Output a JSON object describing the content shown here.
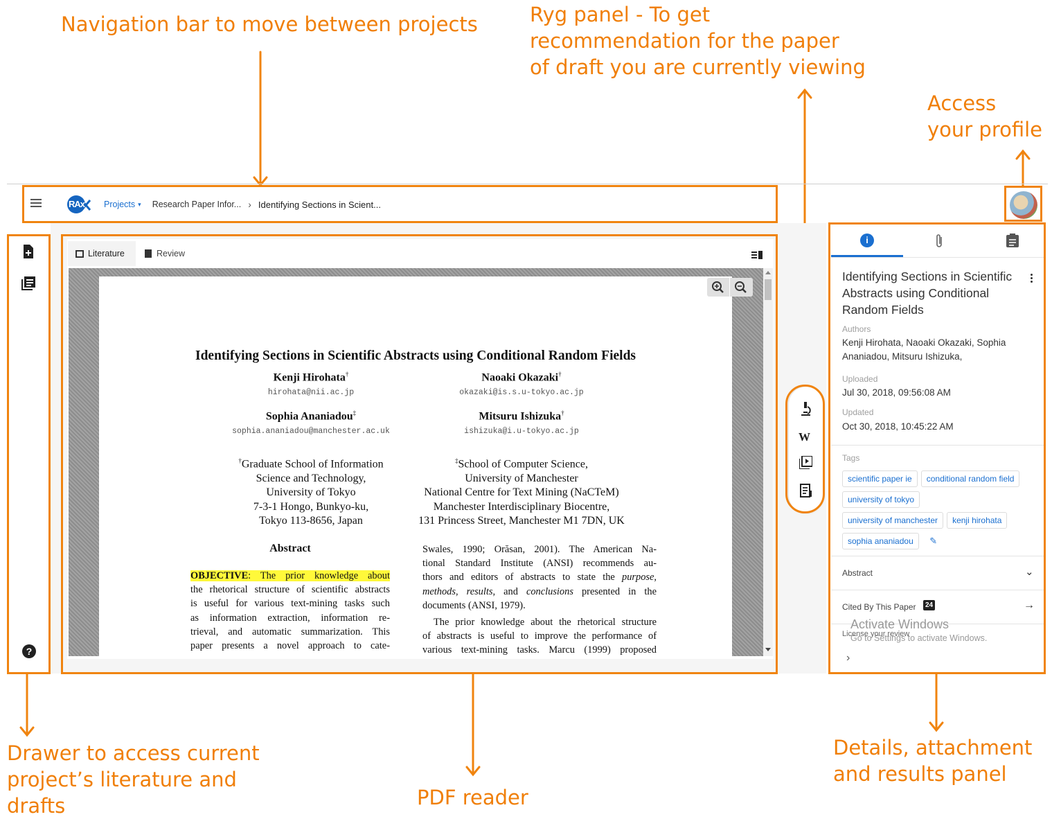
{
  "annotations": {
    "nav": "Navigation bar to move between projects",
    "ryg": [
      "Ryg panel - To get",
      "recommendation for the paper",
      "of draft you are currently viewing"
    ],
    "profile": [
      "Access",
      "your profile"
    ],
    "drawer": [
      "Drawer to access current",
      "project’s literature and",
      "drafts"
    ],
    "pdf": "PDF reader",
    "details": [
      "Details, attachment",
      "and results panel"
    ]
  },
  "appbar": {
    "logo": "RAx",
    "projects": "Projects",
    "crumb_project": "Research Paper Infor...",
    "crumb_separator": "›",
    "crumb_current": "Identifying Sections in Scient..."
  },
  "reader": {
    "tabs": [
      {
        "label": "Literature"
      },
      {
        "label": "Review"
      }
    ]
  },
  "paper": {
    "title": "Identifying Sections in Scientific Abstracts using Conditional Random Fields",
    "authors": [
      {
        "name": "Kenji Hirohata",
        "mark": "†",
        "email": "hirohata@nii.ac.jp"
      },
      {
        "name": "Naoaki Okazaki",
        "mark": "†",
        "email": "okazaki@is.s.u-tokyo.ac.jp"
      },
      {
        "name": "Sophia Ananiadou",
        "mark": "‡",
        "email": "sophia.ananiadou@manchester.ac.uk"
      },
      {
        "name": "Mitsuru Ishizuka",
        "mark": "†",
        "email": "ishizuka@i.u-tokyo.ac.jp"
      }
    ],
    "aff1": [
      "Graduate School of Information",
      "Science and Technology,",
      "University of Tokyo",
      "7-3-1 Hongo, Bunkyo-ku,",
      "Tokyo 113-8656, Japan"
    ],
    "aff1_mark": "†",
    "aff2": [
      "School of Computer Science,",
      "University of Manchester",
      "National Centre for Text Mining (NaCTeM)",
      "Manchester Interdisciplinary Biocentre,",
      "131 Princess Street, Manchester M1 7DN, UK"
    ],
    "aff2_mark": "‡",
    "abstract_heading": "Abstract",
    "obj_label": "OBJECTIVE",
    "obj_text": ": The prior knowledge about",
    "left_col": [
      "the rhetorical structure of scientific abstracts",
      "is useful for various text-mining tasks such",
      "as information extraction, information re-",
      "trieval, and automatic summarization. This",
      "paper presents a novel approach to cate-"
    ],
    "right_col_1": [
      "Swales, 1990; Orăsan, 2001). The American Na-",
      "tional Standard Institute (ANSI) recommends au-"
    ],
    "right_col_2a": "thors and editors of abstracts to state the ",
    "right_col_2b": "purpose",
    "right_col_3a": "methods",
    "right_col_3b": ", ",
    "right_col_3c": "results",
    "right_col_3d": ", and ",
    "right_col_3e": "conclusions",
    "right_col_3f": " presented in the",
    "right_col_4": "documents (ANSI, 1979).",
    "right_col_5": [
      "The prior knowledge about the rhetorical structure",
      "of abstracts is useful to improve the performance of",
      "various text-mining tasks. Marcu (1999) proposed"
    ]
  },
  "ryg_icons": [
    "microscope-icon",
    "wikipedia-icon",
    "video-icon",
    "article-icon"
  ],
  "ryg_wiki_letter": "W",
  "details": {
    "title": "Identifying Sections in Scientific Abstracts using Conditional Random Fields",
    "authors_label": "Authors",
    "authors": "Kenji Hirohata, Naoaki Okazaki, Sophia Ananiadou, Mitsuru Ishizuka,",
    "uploaded_label": "Uploaded",
    "uploaded": "Jul 30, 2018, 09:56:08 AM",
    "updated_label": "Updated",
    "updated": "Oct 30, 2018, 10:45:22 AM",
    "tags_label": "Tags",
    "tags": [
      "scientific paper ie",
      "conditional random field",
      "university of tokyo",
      "university of manchester",
      "kenji hirohata",
      "sophia ananiadou"
    ],
    "abstract_label": "Abstract",
    "cited_label": "Cited By This Paper",
    "cited_count": "24",
    "license_label": "License your review",
    "watermark_title": "Activate Windows",
    "watermark_sub": "Go to Settings to activate Windows."
  },
  "colors": {
    "accent": "#f0840f",
    "link": "#1a6fd0",
    "highlight": "#fff93a"
  }
}
